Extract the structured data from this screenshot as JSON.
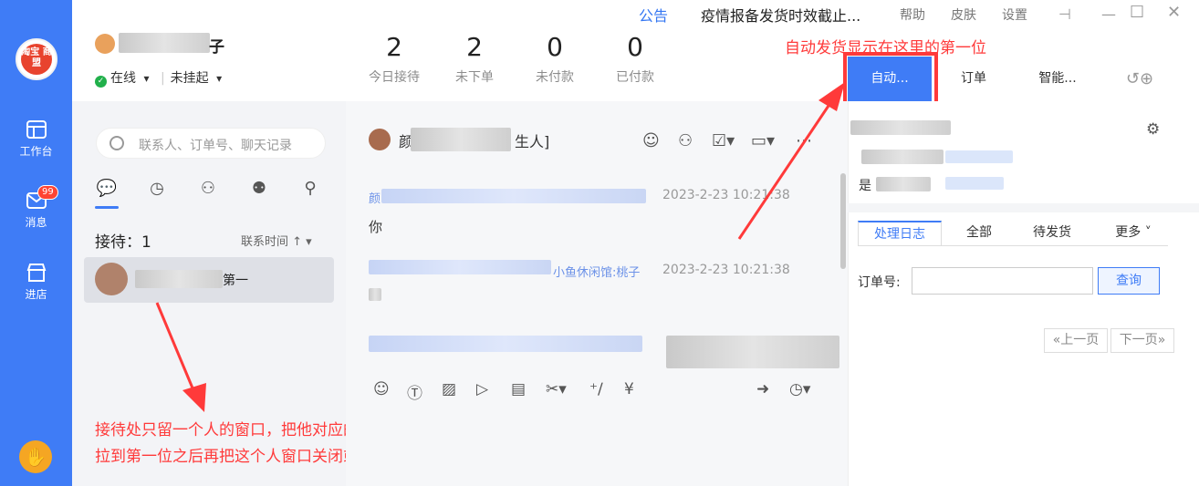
{
  "sidebar": {
    "logo_text": "淘宝 商盟",
    "items": [
      {
        "label": "工作台",
        "icon": "workbench-icon"
      },
      {
        "label": "消息",
        "icon": "message-icon",
        "badge": "99"
      },
      {
        "label": "进店",
        "icon": "store-icon"
      }
    ]
  },
  "header": {
    "name_suffix": "子",
    "status": "在线",
    "status_arrow": "▾",
    "hangup": "未挂起",
    "stats": [
      {
        "num": "2",
        "label": "今日接待"
      },
      {
        "num": "2",
        "label": "未下单"
      },
      {
        "num": "0",
        "label": "未付款"
      },
      {
        "num": "0",
        "label": "已付款"
      }
    ],
    "announce_label": "公告",
    "announce_text": "疫情报备发货时效截止...",
    "menu": [
      "帮助",
      "皮肤",
      "设置"
    ]
  },
  "plugin_tabs": [
    "自动...",
    "订单",
    "智能..."
  ],
  "annotations": {
    "top": "自动发货显示在这里的第一位",
    "bottom_line1": "接待处只留一个人的窗口，把他对应的右侧插件拉到第一位",
    "bottom_line2": "拉到第一位之后再把这个人窗口关闭或者按esc关闭窗口即"
  },
  "left": {
    "search_placeholder": "联系人、订单号、聊天记录",
    "reception": "接待：1",
    "sort": "联系时间",
    "contact_text": "第一"
  },
  "chat": {
    "head_prefix": "颜",
    "head_suffix": "生人]",
    "messages": [
      {
        "name": "颜",
        "time": "2023-2-23 10:21:38",
        "body": "你"
      },
      {
        "name": "小鱼休闲馆:桃子",
        "time": "2023-2-23 10:21:38",
        "body": ""
      }
    ]
  },
  "right": {
    "line2": "是",
    "tabs": [
      "处理日志",
      "全部",
      "待发货",
      "更多"
    ],
    "order_label": "订单号:",
    "query": "查询",
    "prev": "«上一页",
    "next": "下一页»"
  }
}
